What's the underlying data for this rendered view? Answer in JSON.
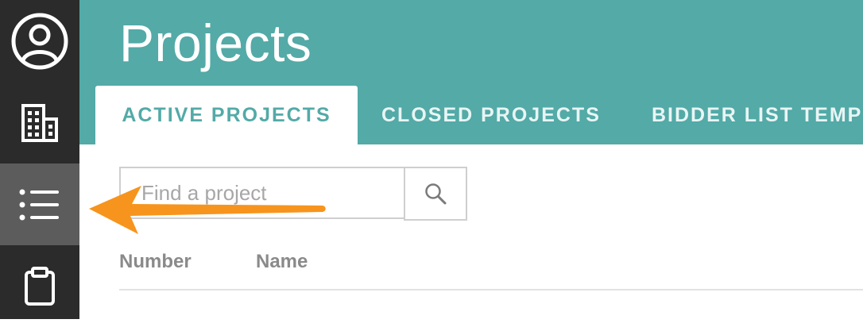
{
  "header": {
    "title": "Projects",
    "accent_color": "#53aaa7"
  },
  "tabs": [
    {
      "label": "ACTIVE PROJECTS",
      "active": true
    },
    {
      "label": "CLOSED PROJECTS",
      "active": false
    },
    {
      "label": "BIDDER LIST TEMP",
      "active": false
    }
  ],
  "sidebar": {
    "background": "#2b2b2b",
    "items": [
      {
        "icon": "user-circle-icon",
        "active": false
      },
      {
        "icon": "building-icon",
        "active": false
      },
      {
        "icon": "list-icon",
        "active": true
      },
      {
        "icon": "clipboard-icon",
        "active": false
      }
    ]
  },
  "search": {
    "placeholder": "Find a project",
    "value": "",
    "button_icon": "search-icon"
  },
  "table": {
    "columns": [
      "Number",
      "Name"
    ]
  },
  "annotation": {
    "icon": "arrow-left-icon",
    "color": "#f7941d"
  }
}
